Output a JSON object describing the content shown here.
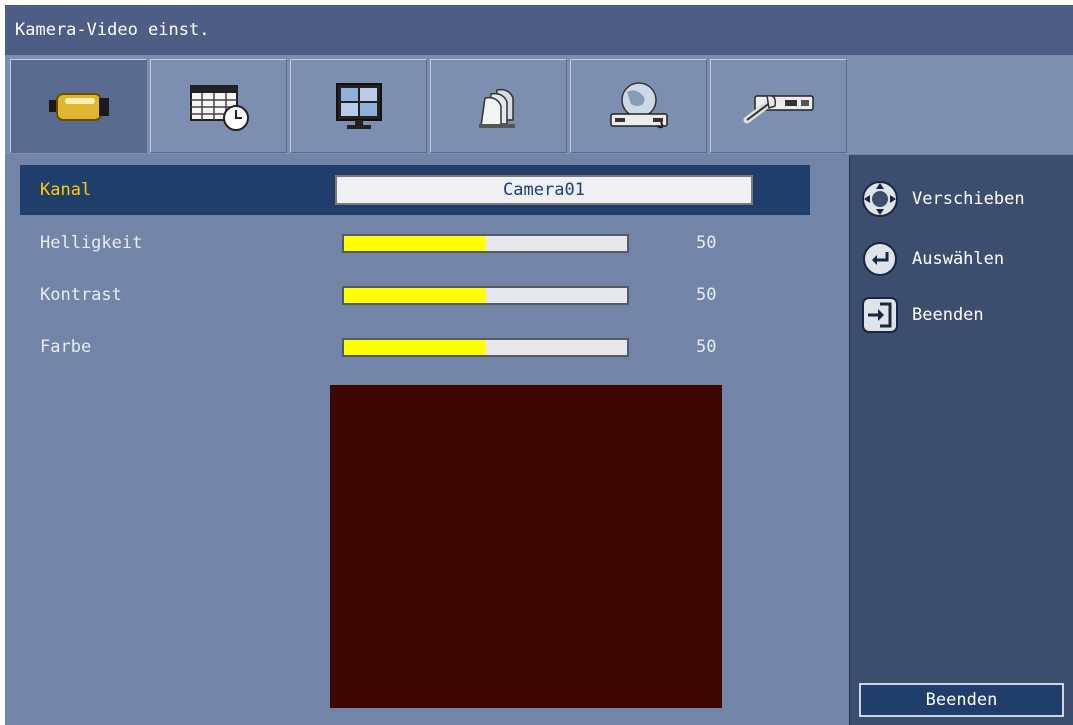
{
  "window": {
    "title": "Kamera-Video  einst."
  },
  "tabs": [
    {
      "icon": "camera-icon",
      "active": true
    },
    {
      "icon": "schedule-icon",
      "active": false
    },
    {
      "icon": "monitor-icon",
      "active": false
    },
    {
      "icon": "multi-camera-icon",
      "active": false
    },
    {
      "icon": "network-icon",
      "active": false
    },
    {
      "icon": "system-tools-icon",
      "active": false
    }
  ],
  "settings": {
    "channel": {
      "label": "Kanal",
      "value": "Camera01"
    },
    "brightness": {
      "label": "Helligkeit",
      "value": "50",
      "level": 50
    },
    "contrast": {
      "label": "Kontrast",
      "value": "50",
      "level": 50
    },
    "color": {
      "label": "Farbe",
      "value": "50",
      "level": 50
    }
  },
  "legend": {
    "move": {
      "icon": "dpad-icon",
      "label": "Verschieben"
    },
    "select": {
      "icon": "enter-icon",
      "label": "Auswählen"
    },
    "exit": {
      "icon": "exit-icon",
      "label": "Beenden"
    }
  },
  "buttons": {
    "exit_label": "Beenden"
  },
  "colors": {
    "title_bar": "#4e5d85",
    "panel": "#7285a8",
    "side_panel": "#3c4e70",
    "selection": "#1f3e6b",
    "highlight_text": "#ffcc00",
    "slider_fill": "#ffff00",
    "preview": "#3e0800"
  }
}
